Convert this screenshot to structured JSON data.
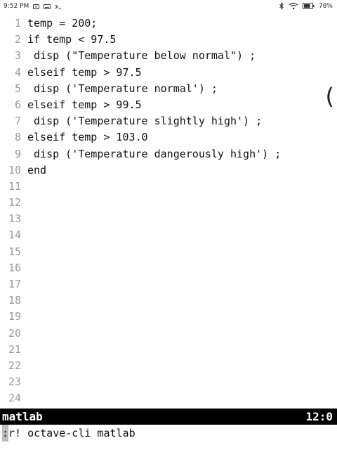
{
  "status_bar": {
    "time": "9:52 PM",
    "battery": "78%",
    "icons": [
      "media-icon",
      "keyboard-icon",
      "terminal-prompt-icon",
      "bluetooth-icon",
      "wifi-icon",
      "battery-icon"
    ]
  },
  "editor": {
    "lines": [
      {
        "num": "1",
        "text": "temp = 200;"
      },
      {
        "num": "2",
        "text": "if temp < 97.5"
      },
      {
        "num": "3",
        "text": " disp (\"Temperature below normal\") ;"
      },
      {
        "num": "4",
        "text": "elseif temp > 97.5"
      },
      {
        "num": "5",
        "text": " disp ('Temperature normal') ;"
      },
      {
        "num": "6",
        "text": "elseif temp > 99.5"
      },
      {
        "num": "7",
        "text": " disp ('Temperature slightly high') ;"
      },
      {
        "num": "8",
        "text": "elseif temp > 103.0"
      },
      {
        "num": "9",
        "text": " disp ('Temperature dangerously high') ;"
      },
      {
        "num": "10",
        "text": "end"
      },
      {
        "num": "11",
        "text": ""
      },
      {
        "num": "12",
        "text": ""
      },
      {
        "num": "13",
        "text": ""
      },
      {
        "num": "14",
        "text": ""
      },
      {
        "num": "15",
        "text": ""
      },
      {
        "num": "16",
        "text": ""
      },
      {
        "num": "17",
        "text": ""
      },
      {
        "num": "18",
        "text": ""
      },
      {
        "num": "19",
        "text": ""
      },
      {
        "num": "20",
        "text": ""
      },
      {
        "num": "21",
        "text": ""
      },
      {
        "num": "22",
        "text": ""
      },
      {
        "num": "23",
        "text": ""
      },
      {
        "num": "24",
        "text": ""
      }
    ],
    "edge_mark": "("
  },
  "statusline": {
    "filename": "matlab",
    "position": "12:0"
  },
  "cmdline": {
    "prefix": ":",
    "command": "r! octave-cli matlab"
  }
}
